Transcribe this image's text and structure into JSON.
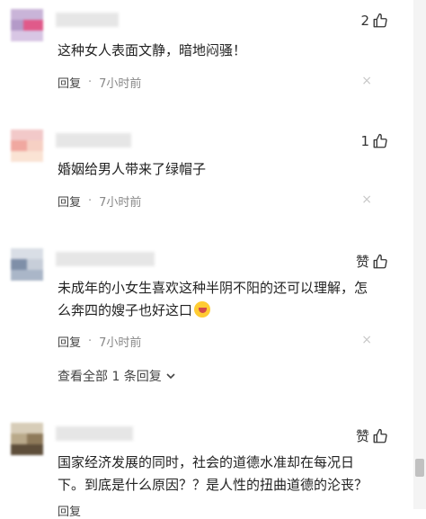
{
  "colors": {
    "text": "#222222",
    "meta": "#888888",
    "link": "#444444",
    "close": "#c8c8c8",
    "scrollbar_thumb": "#c1c1c1"
  },
  "comments": [
    {
      "likes": "2",
      "text": "这种女人表面文静，暗地闷骚！",
      "reply_label": "回复",
      "separator": "·",
      "time": "7小时前",
      "close_glyph": "×"
    },
    {
      "likes": "1",
      "text": "婚姻给男人带来了绿帽子",
      "reply_label": "回复",
      "separator": "·",
      "time": "7小时前",
      "close_glyph": "×"
    },
    {
      "likes": "赞",
      "text_line1": "未成年的小女生喜欢这种半阴不阳的还可以理解，怎",
      "text_line2": "么奔四的嫂子也好这口",
      "emoji": "laughing-emoji",
      "reply_label": "回复",
      "separator": "·",
      "time": "7小时前",
      "close_glyph": "×",
      "view_replies": "查看全部 1 条回复"
    },
    {
      "likes": "赞",
      "text_line1": "国家经济发展的同时，社会的道德水准却在每况日",
      "text_line2": "下。到底是什么原因？？是人性的扭曲道德的沦丧？",
      "reply_label": "回复"
    }
  ]
}
